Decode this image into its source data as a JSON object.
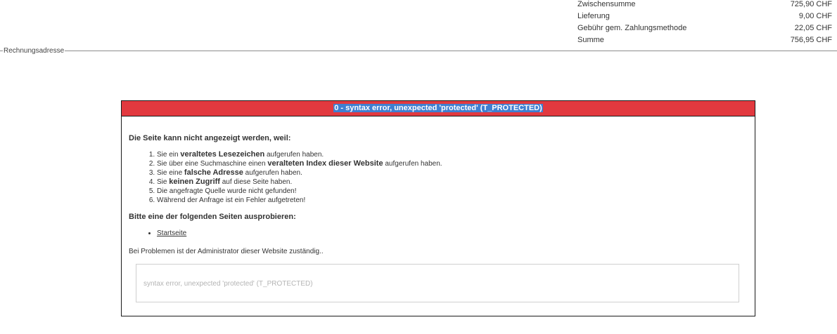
{
  "totals": [
    {
      "label": "Zwischensumme",
      "value": "725,90 CHF"
    },
    {
      "label": "Lieferung",
      "value": "9,00 CHF"
    },
    {
      "label": "Gebühr gem. Zahlungsmethode",
      "value": "22,05 CHF"
    },
    {
      "label": "Summe",
      "value": "756,95 CHF"
    }
  ],
  "billing": {
    "legend": "Rechnungsadresse"
  },
  "error": {
    "title": "0 - syntax error, unexpected 'protected' (T_PROTECTED)",
    "intro": "Die Seite kann nicht angezeigt werden, weil:",
    "reasons": [
      {
        "pre": "Sie ein ",
        "bold": "veraltetes Lesezeichen",
        "post": " aufgerufen haben."
      },
      {
        "pre": "Sie über eine Suchmaschine einen ",
        "bold": "veralteten Index dieser Website",
        "post": " aufgerufen haben."
      },
      {
        "pre": "Sie eine ",
        "bold": "falsche Adresse",
        "post": " aufgerufen haben."
      },
      {
        "pre": "Sie ",
        "bold": "keinen Zugriff",
        "post": " auf diese Seite haben."
      },
      {
        "pre": "Die angefragte Quelle wurde nicht gefunden!",
        "bold": "",
        "post": ""
      },
      {
        "pre": "Während der Anfrage ist ein Fehler aufgetreten!",
        "bold": "",
        "post": ""
      }
    ],
    "try_heading": "Bitte eine der folgenden Seiten ausprobieren:",
    "links": [
      {
        "label": "Startseite"
      }
    ],
    "admin_note": "Bei Problemen ist der Administrator dieser Website zuständig..",
    "message": "syntax error, unexpected 'protected' (T_PROTECTED)"
  },
  "colors": {
    "header_bg": "#e2393f",
    "selection_bg": "#3f7fd1",
    "border": "#1a1a1a"
  }
}
